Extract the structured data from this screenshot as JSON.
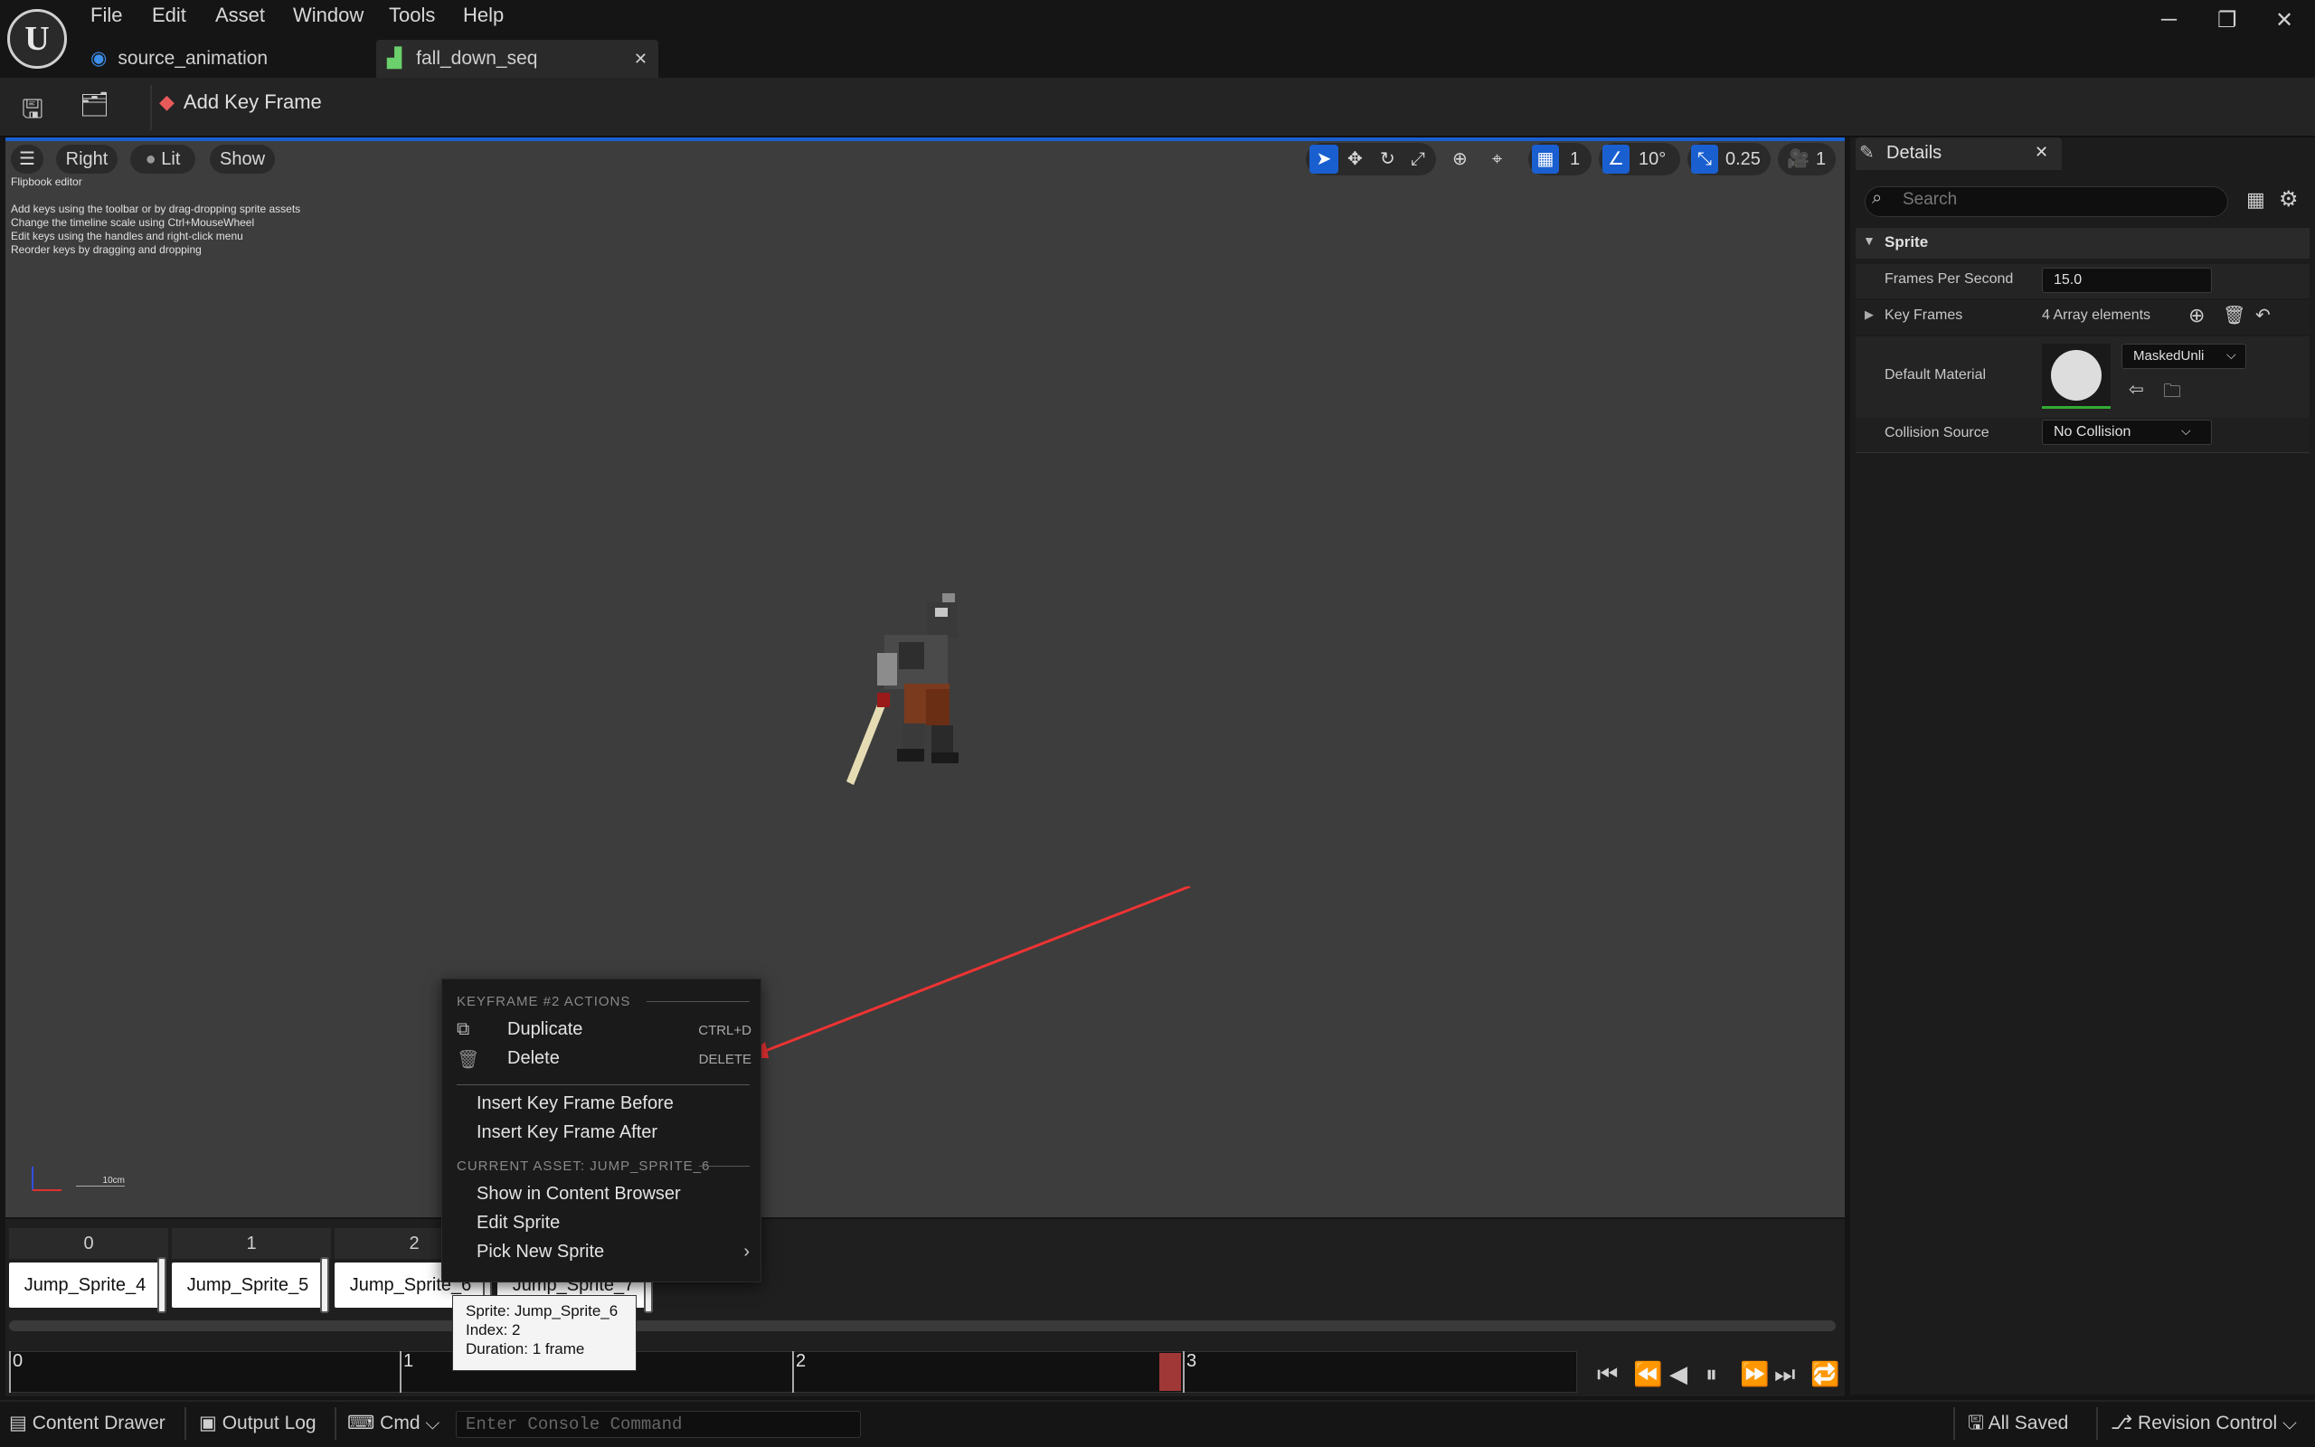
{
  "menu": [
    "File",
    "Edit",
    "Asset",
    "Window",
    "Tools",
    "Help"
  ],
  "tabs": {
    "tab1": "source_animation",
    "tab2": "fall_down_seq"
  },
  "toolbar": {
    "add_key_frame": "Add Key Frame"
  },
  "viewport": {
    "view": "Right",
    "lit": "Lit",
    "show": "Show",
    "editor_label": "Flipbook editor",
    "hints": [
      "Add keys using the toolbar or by drag-dropping sprite assets",
      "Change the timeline scale using Ctrl+MouseWheel",
      "Edit keys using the handles and right-click menu",
      "Reorder keys by dragging and dropping"
    ],
    "grid_snap": "1",
    "rotation_snap": "10°",
    "scale_snap": "0.25",
    "camera_speed": "1",
    "scale_label": "10cm"
  },
  "details": {
    "title": "Details",
    "search_placeholder": "Search",
    "category": "Sprite",
    "fps_label": "Frames Per Second",
    "fps_value": "15.0",
    "keyframes_label": "Key Frames",
    "keyframes_value": "4 Array elements",
    "material_label": "Default Material",
    "material_value": "MaskedUnli",
    "collision_label": "Collision Source",
    "collision_value": "No Collision"
  },
  "timeline": {
    "frames": [
      {
        "index": "0",
        "name": "Jump_Sprite_4"
      },
      {
        "index": "1",
        "name": "Jump_Sprite_5"
      },
      {
        "index": "2",
        "name": "Jump_Sprite_6"
      },
      {
        "index": "3",
        "name": "Jump_Sprite_7"
      }
    ],
    "ticks": [
      "0",
      "1",
      "2",
      "3"
    ]
  },
  "context_menu": {
    "header1": "KEYFRAME #2 ACTIONS",
    "duplicate": "Duplicate",
    "duplicate_shortcut": "CTRL+D",
    "delete": "Delete",
    "delete_shortcut": "DELETE",
    "insert_before": "Insert Key Frame Before",
    "insert_after": "Insert Key Frame After",
    "header2": "CURRENT ASSET: JUMP_SPRITE_6",
    "show_in_browser": "Show in Content Browser",
    "edit_sprite": "Edit Sprite",
    "pick_new": "Pick New Sprite"
  },
  "tooltip": {
    "sprite": "Sprite: Jump_Sprite_6",
    "index": "Index: 2",
    "duration": "Duration: 1 frame"
  },
  "statusbar": {
    "content_drawer": "Content Drawer",
    "output_log": "Output Log",
    "cmd": "Cmd",
    "console_placeholder": "Enter Console Command",
    "all_saved": "All Saved",
    "revision_control": "Revision Control"
  }
}
